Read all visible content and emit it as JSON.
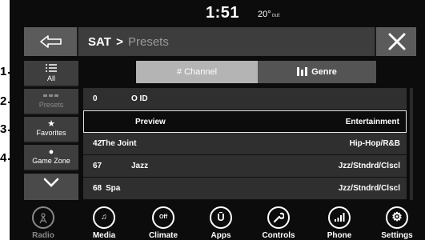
{
  "status": {
    "time": "1:51",
    "temp": "20°",
    "temp_unit": "out"
  },
  "header": {
    "section": "SAT",
    "separator": ">",
    "page": "Presets"
  },
  "sidebar": {
    "all": "All",
    "presets": "Presets",
    "favorites": "Favorites",
    "gamezone": "Game Zone"
  },
  "callouts": [
    "1",
    "2",
    "3",
    "4"
  ],
  "tabs": {
    "channel": "# Channel",
    "genre": "Genre"
  },
  "rows": [
    {
      "num": "0",
      "name": "O ID",
      "genre": ""
    },
    {
      "num": "",
      "name": "Preview",
      "genre": "Entertainment"
    },
    {
      "num": "42",
      "name": "The Joint",
      "genre": "Hip-Hop/R&B"
    },
    {
      "num": "67",
      "name": "Jazz",
      "genre": "Jzz/Stndrd/Clscl"
    },
    {
      "num": "68",
      "name": "Spa",
      "genre": "Jzz/Stndrd/Clscl"
    }
  ],
  "nav": {
    "radio": "Radio",
    "media": "Media",
    "climate": "Climate",
    "climate_icon_text": "Off",
    "apps": "Apps",
    "controls": "Controls",
    "phone": "Phone",
    "settings": "Settings"
  },
  "colors": {
    "background": "#0c0c0c",
    "header": "#3d3d3d",
    "tab_active": "#b4b4b4",
    "row": "#2f2f2f"
  }
}
